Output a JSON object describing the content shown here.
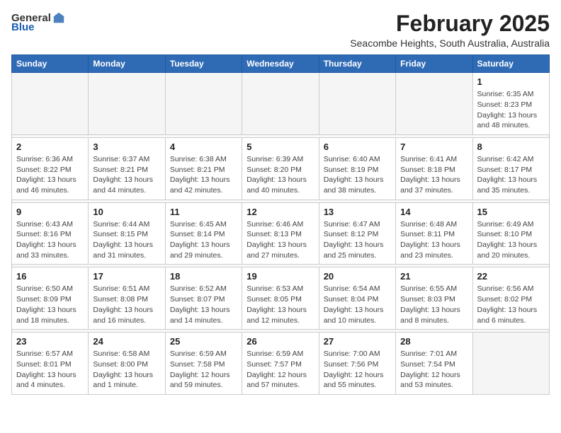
{
  "header": {
    "logo": {
      "general": "General",
      "blue": "Blue"
    },
    "title": "February 2025",
    "subtitle": "Seacombe Heights, South Australia, Australia"
  },
  "calendar": {
    "days_of_week": [
      "Sunday",
      "Monday",
      "Tuesday",
      "Wednesday",
      "Thursday",
      "Friday",
      "Saturday"
    ],
    "weeks": [
      [
        {
          "day": "",
          "info": ""
        },
        {
          "day": "",
          "info": ""
        },
        {
          "day": "",
          "info": ""
        },
        {
          "day": "",
          "info": ""
        },
        {
          "day": "",
          "info": ""
        },
        {
          "day": "",
          "info": ""
        },
        {
          "day": "1",
          "info": "Sunrise: 6:35 AM\nSunset: 8:23 PM\nDaylight: 13 hours\nand 48 minutes."
        }
      ],
      [
        {
          "day": "2",
          "info": "Sunrise: 6:36 AM\nSunset: 8:22 PM\nDaylight: 13 hours\nand 46 minutes."
        },
        {
          "day": "3",
          "info": "Sunrise: 6:37 AM\nSunset: 8:21 PM\nDaylight: 13 hours\nand 44 minutes."
        },
        {
          "day": "4",
          "info": "Sunrise: 6:38 AM\nSunset: 8:21 PM\nDaylight: 13 hours\nand 42 minutes."
        },
        {
          "day": "5",
          "info": "Sunrise: 6:39 AM\nSunset: 8:20 PM\nDaylight: 13 hours\nand 40 minutes."
        },
        {
          "day": "6",
          "info": "Sunrise: 6:40 AM\nSunset: 8:19 PM\nDaylight: 13 hours\nand 38 minutes."
        },
        {
          "day": "7",
          "info": "Sunrise: 6:41 AM\nSunset: 8:18 PM\nDaylight: 13 hours\nand 37 minutes."
        },
        {
          "day": "8",
          "info": "Sunrise: 6:42 AM\nSunset: 8:17 PM\nDaylight: 13 hours\nand 35 minutes."
        }
      ],
      [
        {
          "day": "9",
          "info": "Sunrise: 6:43 AM\nSunset: 8:16 PM\nDaylight: 13 hours\nand 33 minutes."
        },
        {
          "day": "10",
          "info": "Sunrise: 6:44 AM\nSunset: 8:15 PM\nDaylight: 13 hours\nand 31 minutes."
        },
        {
          "day": "11",
          "info": "Sunrise: 6:45 AM\nSunset: 8:14 PM\nDaylight: 13 hours\nand 29 minutes."
        },
        {
          "day": "12",
          "info": "Sunrise: 6:46 AM\nSunset: 8:13 PM\nDaylight: 13 hours\nand 27 minutes."
        },
        {
          "day": "13",
          "info": "Sunrise: 6:47 AM\nSunset: 8:12 PM\nDaylight: 13 hours\nand 25 minutes."
        },
        {
          "day": "14",
          "info": "Sunrise: 6:48 AM\nSunset: 8:11 PM\nDaylight: 13 hours\nand 23 minutes."
        },
        {
          "day": "15",
          "info": "Sunrise: 6:49 AM\nSunset: 8:10 PM\nDaylight: 13 hours\nand 20 minutes."
        }
      ],
      [
        {
          "day": "16",
          "info": "Sunrise: 6:50 AM\nSunset: 8:09 PM\nDaylight: 13 hours\nand 18 minutes."
        },
        {
          "day": "17",
          "info": "Sunrise: 6:51 AM\nSunset: 8:08 PM\nDaylight: 13 hours\nand 16 minutes."
        },
        {
          "day": "18",
          "info": "Sunrise: 6:52 AM\nSunset: 8:07 PM\nDaylight: 13 hours\nand 14 minutes."
        },
        {
          "day": "19",
          "info": "Sunrise: 6:53 AM\nSunset: 8:05 PM\nDaylight: 13 hours\nand 12 minutes."
        },
        {
          "day": "20",
          "info": "Sunrise: 6:54 AM\nSunset: 8:04 PM\nDaylight: 13 hours\nand 10 minutes."
        },
        {
          "day": "21",
          "info": "Sunrise: 6:55 AM\nSunset: 8:03 PM\nDaylight: 13 hours\nand 8 minutes."
        },
        {
          "day": "22",
          "info": "Sunrise: 6:56 AM\nSunset: 8:02 PM\nDaylight: 13 hours\nand 6 minutes."
        }
      ],
      [
        {
          "day": "23",
          "info": "Sunrise: 6:57 AM\nSunset: 8:01 PM\nDaylight: 13 hours\nand 4 minutes."
        },
        {
          "day": "24",
          "info": "Sunrise: 6:58 AM\nSunset: 8:00 PM\nDaylight: 13 hours\nand 1 minute."
        },
        {
          "day": "25",
          "info": "Sunrise: 6:59 AM\nSunset: 7:58 PM\nDaylight: 12 hours\nand 59 minutes."
        },
        {
          "day": "26",
          "info": "Sunrise: 6:59 AM\nSunset: 7:57 PM\nDaylight: 12 hours\nand 57 minutes."
        },
        {
          "day": "27",
          "info": "Sunrise: 7:00 AM\nSunset: 7:56 PM\nDaylight: 12 hours\nand 55 minutes."
        },
        {
          "day": "28",
          "info": "Sunrise: 7:01 AM\nSunset: 7:54 PM\nDaylight: 12 hours\nand 53 minutes."
        },
        {
          "day": "",
          "info": ""
        }
      ]
    ]
  }
}
